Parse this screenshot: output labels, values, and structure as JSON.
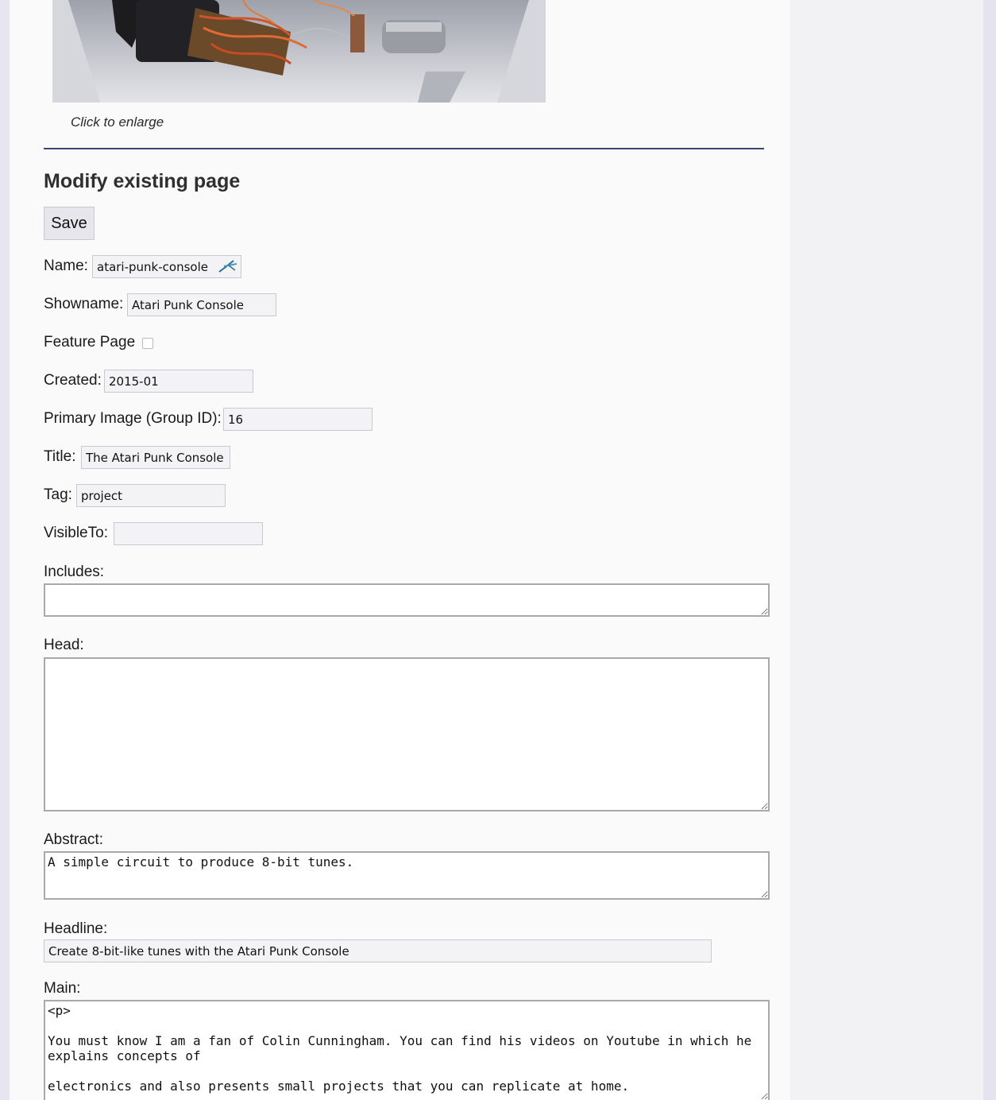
{
  "image_caption": "Click to enlarge",
  "heading": "Modify existing page",
  "save_label": "Save",
  "fields": {
    "name": {
      "label": "Name:",
      "value": "atari-punk-console"
    },
    "showname": {
      "label": "Showname:",
      "value": "Atari Punk Console"
    },
    "feature": {
      "label": "Feature Page",
      "checked": false
    },
    "created": {
      "label": "Created:",
      "value": "2015-01"
    },
    "primary_image": {
      "label": "Primary Image (Group ID):",
      "value": "16"
    },
    "title": {
      "label": "Title:",
      "value": "The Atari Punk Console | N"
    },
    "tag": {
      "label": "Tag:",
      "value": "project"
    },
    "visible_to": {
      "label": "VisibleTo:",
      "value": ""
    },
    "includes": {
      "label": "Includes:",
      "value": ""
    },
    "head": {
      "label": "Head:",
      "value": ""
    },
    "abstract": {
      "label": "Abstract:",
      "value": "A simple circuit to produce 8-bit tunes."
    },
    "headline": {
      "label": "Headline:",
      "value": "Create 8-bit-like tunes with the Atari Punk Console"
    },
    "main": {
      "label": "Main:",
      "value": "<p>\n\nYou must know I am a fan of Colin Cunningham. You can find his videos on Youtube in which he explains concepts of\n\nelectronics and also presents small projects that you can replicate at home."
    }
  }
}
